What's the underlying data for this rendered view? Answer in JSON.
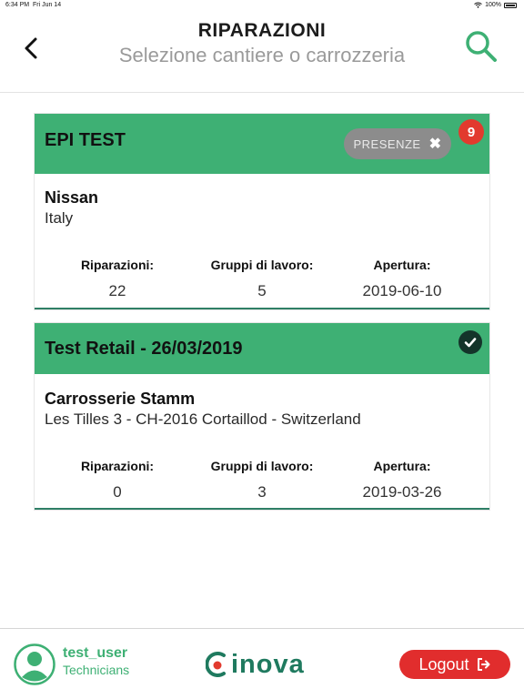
{
  "status_bar": {
    "time": "6:34 PM",
    "date": "Fri Jun 14",
    "battery": "100%"
  },
  "header": {
    "title": "RIPARAZIONI",
    "subtitle": "Selezione cantiere o carrozzeria",
    "back_icon": "chevron-left-icon",
    "search_icon": "search-icon"
  },
  "colors": {
    "accent_green": "#3eb074",
    "dark_green": "#1f7a5f",
    "badge_red": "#e23a2e",
    "logout_red": "#e12d2d",
    "pill_gray": "#8c8c8c"
  },
  "cards": [
    {
      "title": "EPI TEST",
      "presenze_label": "PRESENZE",
      "badge_count": "9",
      "company": "Nissan",
      "address": "Italy",
      "stats": [
        {
          "label": "Riparazioni:",
          "value": "22"
        },
        {
          "label": "Gruppi di lavoro:",
          "value": "5"
        },
        {
          "label": "Apertura:",
          "value": "2019-06-10"
        }
      ]
    },
    {
      "title": "Test Retail - 26/03/2019",
      "status_icon": "check-circle-icon",
      "company": "Carrosserie Stamm",
      "address": "Les Tilles 3 - CH-2016 Cortaillod - Switzerland",
      "stats": [
        {
          "label": "Riparazioni:",
          "value": "0"
        },
        {
          "label": "Gruppi di lavoro:",
          "value": "3"
        },
        {
          "label": "Apertura:",
          "value": "2019-03-26"
        }
      ]
    }
  ],
  "footer": {
    "username": "test_user",
    "role": "Technicians",
    "logo_text": "inova",
    "logout_label": "Logout"
  }
}
